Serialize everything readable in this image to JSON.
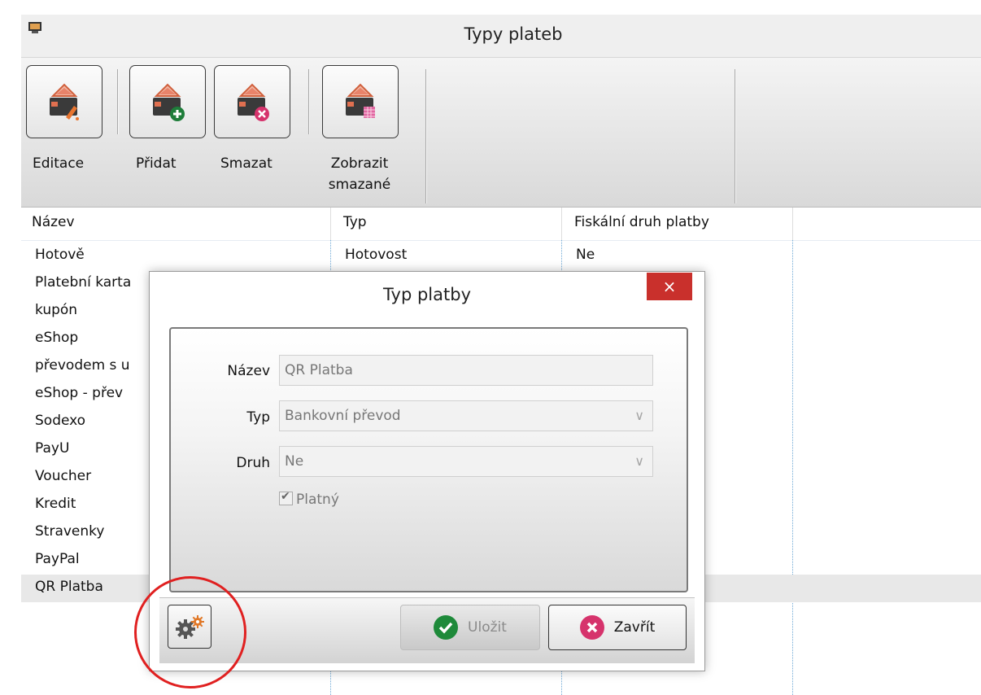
{
  "window": {
    "title": "Typy plateb",
    "app_icon": "monitor-icon"
  },
  "toolbar": {
    "buttons": [
      {
        "label": "Editace",
        "icon": "wallet-edit-icon"
      },
      {
        "label": "Přidat",
        "icon": "wallet-add-icon"
      },
      {
        "label": "Smazat",
        "icon": "wallet-delete-icon"
      },
      {
        "label": "Zobrazit smazané",
        "icon": "wallet-show-deleted-icon"
      }
    ]
  },
  "table": {
    "columns": [
      "Název",
      "Typ",
      "Fiskální druh platby"
    ],
    "rows": [
      {
        "name": "Hotově",
        "type": "Hotovost",
        "fiscal": "Ne"
      },
      {
        "name": "Platební karta",
        "type": "",
        "fiscal": ""
      },
      {
        "name": "kupón",
        "type": "",
        "fiscal": ""
      },
      {
        "name": "eShop",
        "type": "",
        "fiscal": ""
      },
      {
        "name": "převodem s u",
        "type": "",
        "fiscal": ""
      },
      {
        "name": "eShop - přev",
        "type": "",
        "fiscal": ""
      },
      {
        "name": "Sodexo",
        "type": "",
        "fiscal": ""
      },
      {
        "name": "PayU",
        "type": "",
        "fiscal": ""
      },
      {
        "name": "Voucher",
        "type": "",
        "fiscal": ""
      },
      {
        "name": "Kredit",
        "type": "",
        "fiscal": ""
      },
      {
        "name": "Stravenky",
        "type": "",
        "fiscal": ""
      },
      {
        "name": "PayPal",
        "type": "",
        "fiscal": ""
      },
      {
        "name": "QR Platba",
        "type": "",
        "fiscal": ""
      }
    ],
    "selected_row": "QR Platba"
  },
  "dialog": {
    "title": "Typ platby",
    "close_glyph": "×",
    "fields": {
      "name_label": "Název",
      "name_value": "QR Platba",
      "type_label": "Typ",
      "type_value": "Bankovní převod",
      "kind_label": "Druh",
      "kind_value": "Ne",
      "valid_label": "Platný",
      "valid_checked": true
    },
    "buttons": {
      "save_label": "Uložit",
      "close_label": "Zavřít"
    },
    "colors": {
      "close_red": "#c9302c",
      "save_green": "#1e8a3a",
      "zavrit_pink": "#d6336c",
      "highlight_circle": "#e02020"
    }
  }
}
